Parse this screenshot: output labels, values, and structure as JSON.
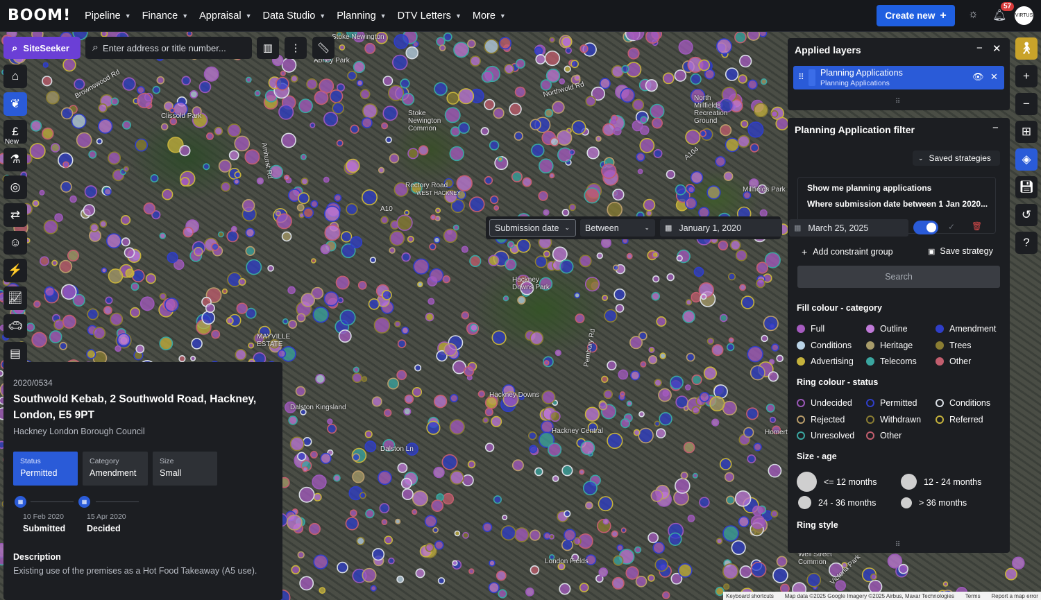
{
  "app": {
    "logo": "BOOM!"
  },
  "nav": [
    {
      "label": "Pipeline"
    },
    {
      "label": "Finance"
    },
    {
      "label": "Appraisal"
    },
    {
      "label": "Data Studio"
    },
    {
      "label": "Planning"
    },
    {
      "label": "DTV Letters"
    },
    {
      "label": "More"
    }
  ],
  "header": {
    "create_label": "Create new",
    "notifications_count": "57",
    "avatar_text": "VIRTUS"
  },
  "toolbar": {
    "siteseeker_label": "SiteSeeker",
    "search_placeholder": "Enter address or title number..."
  },
  "left_rail": {
    "new_label": "New"
  },
  "map_labels": [
    "Stoke Newington",
    "Abney Park",
    "Clissold Park",
    "Stoke Newington Common",
    "North Millfields Recreation Ground",
    "Rectory Road",
    "WEST HACKNEY",
    "Millfields Park",
    "Hackney Downs Park",
    "MAYVILLE ESTATE",
    "Dalston Kingsland",
    "Dalston Ln",
    "Hackney Downs",
    "Hackney Central",
    "London Fields",
    "Well Street Common",
    "Northwold Rd",
    "Brownswood Rd",
    "A10",
    "A104",
    "Amhurst Rd",
    "Pembury Rd",
    "Homerton",
    "Victoria Park"
  ],
  "layers_panel": {
    "title": "Applied layers",
    "layer": {
      "name": "Planning Applications",
      "subtitle": "Planning Applications"
    }
  },
  "filter_panel": {
    "title": "Planning Application filter",
    "saved_strategies": "Saved strategies",
    "show_me": "Show me planning applications",
    "where": "Where submission date between 1 Jan 2020...",
    "constraint": {
      "field": "Submission date",
      "operator": "Between",
      "from": "January 1, 2020",
      "to": "March 25, 2025"
    },
    "add_constraint": "Add constraint group",
    "save_strategy": "Save strategy",
    "search": "Search",
    "fill_title": "Fill colour - category",
    "fill": [
      {
        "label": "Full",
        "color": "#a65bc0"
      },
      {
        "label": "Outline",
        "color": "#c07ad8"
      },
      {
        "label": "Amendment",
        "color": "#2f3ec8"
      },
      {
        "label": "Conditions",
        "color": "#b9d3e6"
      },
      {
        "label": "Heritage",
        "color": "#a89c6a"
      },
      {
        "label": "Trees",
        "color": "#8a7d32"
      },
      {
        "label": "Advertising",
        "color": "#c5b23c"
      },
      {
        "label": "Telecoms",
        "color": "#3aa6a0"
      },
      {
        "label": "Other",
        "color": "#c25e6e"
      }
    ],
    "ring_title": "Ring colour - status",
    "ring": [
      {
        "label": "Undecided",
        "color": "#9b58b8"
      },
      {
        "label": "Permitted",
        "color": "#2f3ec8"
      },
      {
        "label": "Conditions",
        "color": "#d8dde3"
      },
      {
        "label": "Rejected",
        "color": "#b89c6a"
      },
      {
        "label": "Withdrawn",
        "color": "#8a7d32"
      },
      {
        "label": "Referred",
        "color": "#c5b23c"
      },
      {
        "label": "Unresolved",
        "color": "#3aa6a0"
      },
      {
        "label": "Other",
        "color": "#c25e6e"
      }
    ],
    "size_title": "Size - age",
    "sizes": [
      {
        "label": "<= 12 months"
      },
      {
        "label": "12 - 24 months"
      },
      {
        "label": "24 - 36 months"
      },
      {
        "label": "> 36 months"
      }
    ],
    "ring_style_title": "Ring style"
  },
  "info_card": {
    "ref": "2020/0534",
    "address": "Southwold Kebab, 2 Southwold Road, Hackney, London, E5 9PT",
    "council": "Hackney London Borough Council",
    "chips": [
      {
        "key": "Status",
        "value": "Permitted"
      },
      {
        "key": "Category",
        "value": "Amendment"
      },
      {
        "key": "Size",
        "value": "Small"
      }
    ],
    "timeline": [
      {
        "date": "10 Feb 2020",
        "label": "Submitted"
      },
      {
        "date": "15 Apr 2020",
        "label": "Decided"
      }
    ],
    "description_title": "Description",
    "description": "Existing use of the premises as a Hot Food Takeaway (A5 use)."
  },
  "attribution": {
    "left": "Keyboard shortcuts",
    "middle": "Map data ©2025 Google Imagery ©2025 Airbus, Maxar Technologies",
    "terms": "Terms",
    "report": "Report a map error"
  }
}
